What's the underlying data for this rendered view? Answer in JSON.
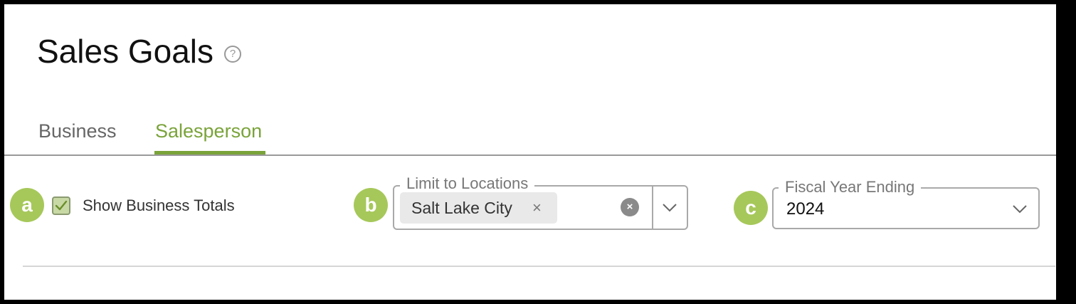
{
  "page": {
    "title": "Sales Goals",
    "help_icon": "question-circle-icon"
  },
  "tabs": [
    {
      "label": "Business",
      "active": false
    },
    {
      "label": "Salesperson",
      "active": true
    }
  ],
  "markers": {
    "a": "a",
    "b": "b",
    "c": "c"
  },
  "show_business_totals": {
    "label": "Show Business Totals",
    "checked": true
  },
  "locations": {
    "legend": "Limit to Locations",
    "chips": [
      {
        "label": "Salt Lake City",
        "remove_glyph": "×"
      }
    ],
    "clear_glyph": "×"
  },
  "fiscal_year": {
    "legend": "Fiscal Year Ending",
    "value": "2024"
  },
  "colors": {
    "accent": "#7aa33a",
    "marker": "#a6c85a",
    "checkbox_fill": "#c8d9a6"
  }
}
